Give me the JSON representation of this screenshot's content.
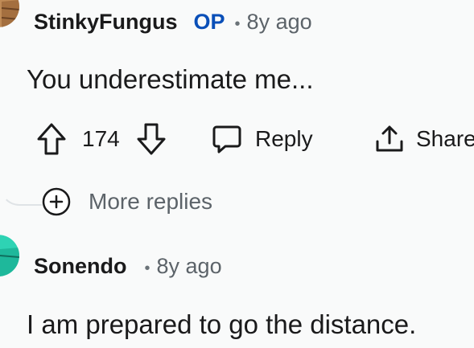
{
  "comment_1": {
    "username": "StinkyFungus",
    "badge": "OP",
    "separator": "•",
    "time": "8y ago",
    "body": "You underestimate me...",
    "score": "174",
    "reply_label": "Reply",
    "share_label": "Share"
  },
  "more_replies": {
    "label": "More replies"
  },
  "comment_2": {
    "username": "Sonendo",
    "separator": "•",
    "time": "8y ago",
    "body": "I am prepared to go the distance."
  },
  "colors": {
    "background": "#f9fafa",
    "op_badge": "#0a4fb8",
    "muted_text": "#5c6369",
    "avatar_1": "#c08b56",
    "avatar_2": "#2ed3b4"
  },
  "icons": {
    "upvote": "arrow-up-outline-icon",
    "downvote": "arrow-down-outline-icon",
    "reply": "speech-bubble-icon",
    "share": "share-upload-icon",
    "more": "plus-circle-icon"
  }
}
